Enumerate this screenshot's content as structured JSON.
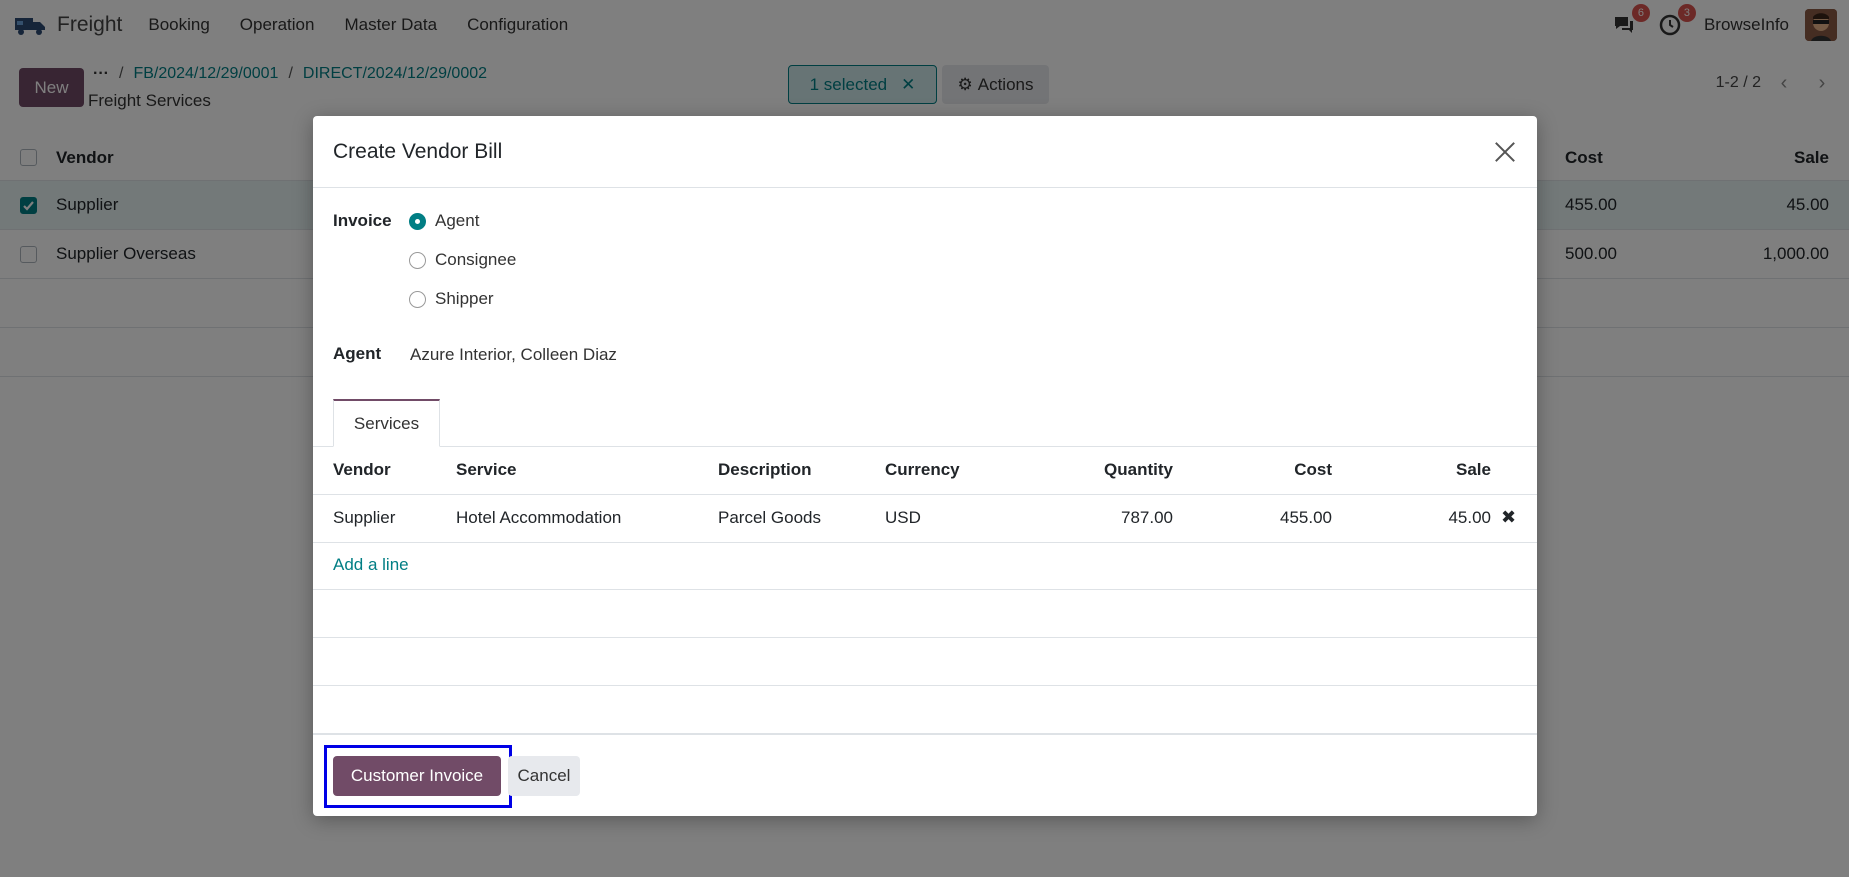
{
  "navbar": {
    "app_name": "Freight",
    "menu": [
      "Booking",
      "Operation",
      "Master Data",
      "Configuration"
    ],
    "messages_count": "6",
    "activities_count": "3",
    "user_name": "BrowseInfo"
  },
  "control": {
    "new_label": "New",
    "breadcrumb_more": "···",
    "breadcrumbs": [
      "FB/2024/12/29/0001",
      "DIRECT/2024/12/29/0002"
    ],
    "title": "Freight Services",
    "selected_label": "1 selected",
    "actions_label": "Actions",
    "pager": "1-2 / 2"
  },
  "list": {
    "headers": {
      "vendor": "Vendor",
      "cost": "Cost",
      "sale": "Sale"
    },
    "rows": [
      {
        "vendor": "Supplier",
        "cost": "455.00",
        "sale": "45.00",
        "checked": true
      },
      {
        "vendor": "Supplier Overseas",
        "cost": "500.00",
        "sale": "1,000.00",
        "checked": false
      }
    ]
  },
  "modal": {
    "title": "Create Vendor Bill",
    "invoice_label": "Invoice",
    "invoice_options": [
      "Agent",
      "Consignee",
      "Shipper"
    ],
    "invoice_selected": "Agent",
    "agent_label": "Agent",
    "agent_value": "Azure Interior, Colleen Diaz",
    "tab_label": "Services",
    "table": {
      "headers": [
        "Vendor",
        "Service",
        "Description",
        "Currency",
        "Quantity",
        "Cost",
        "Sale"
      ],
      "rows": [
        {
          "vendor": "Supplier",
          "service": "Hotel Accommodation",
          "description": "Parcel Goods",
          "currency": "USD",
          "quantity": "787.00",
          "cost": "455.00",
          "sale": "45.00"
        }
      ],
      "add_line": "Add a line"
    },
    "primary_button": "Customer Invoice",
    "cancel_button": "Cancel"
  },
  "colors": {
    "primary": "#714b67",
    "accent": "#017e84",
    "highlight": "#0000e6"
  }
}
